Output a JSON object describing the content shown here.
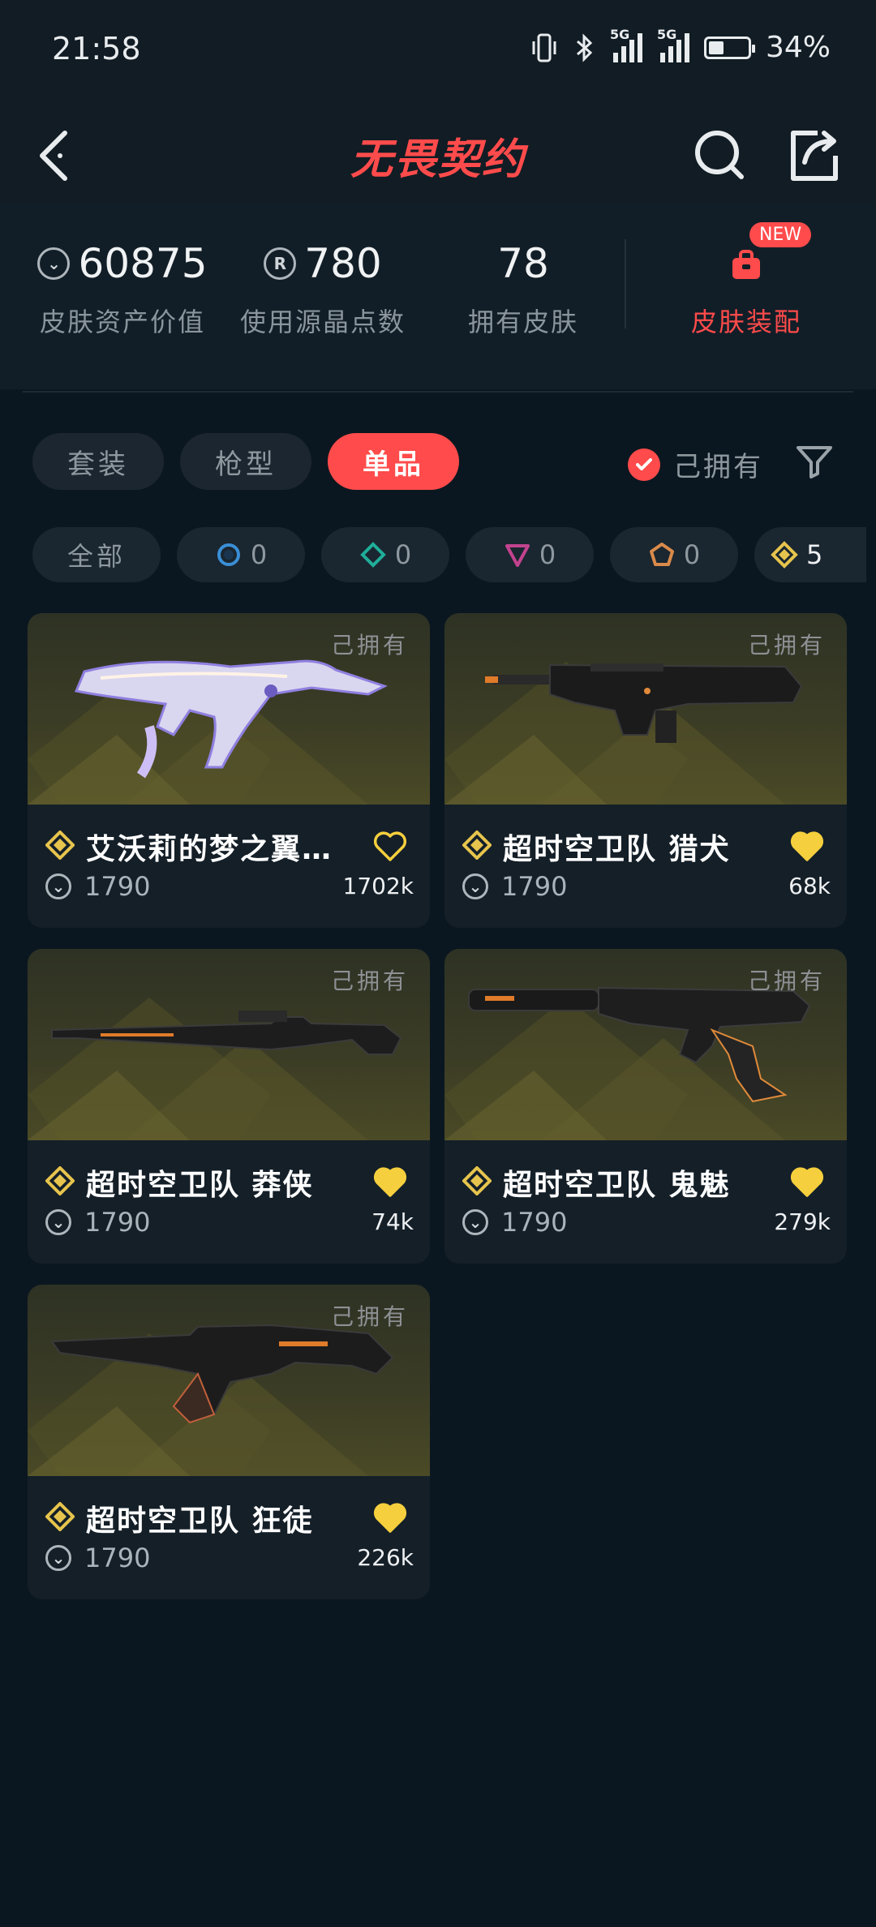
{
  "status_bar": {
    "time": "21:58",
    "network_1": "5G",
    "network_2": "5G",
    "battery": "34%"
  },
  "header": {
    "title": "无畏契约"
  },
  "stats": [
    {
      "value": "60875",
      "label": "皮肤资产价值",
      "icon": "vp-coin-icon"
    },
    {
      "value": "780",
      "label": "使用源晶点数",
      "icon": "radianite-icon"
    },
    {
      "value": "78",
      "label": "拥有皮肤"
    }
  ],
  "equip": {
    "label": "皮肤装配",
    "badge": "NEW"
  },
  "tabs": [
    "套装",
    "枪型",
    "单品"
  ],
  "active_tab": "单品",
  "owned_toggle": {
    "label": "己拥有",
    "checked": true
  },
  "rarity_chips": [
    {
      "label": "全部"
    },
    {
      "count": "0",
      "icon": "select-tier-icon",
      "color": "#3a8fd6"
    },
    {
      "count": "0",
      "icon": "deluxe-tier-icon",
      "color": "#1fae9a"
    },
    {
      "count": "0",
      "icon": "premium-tier-icon",
      "color": "#c3438f"
    },
    {
      "count": "0",
      "icon": "exclusive-tier-icon",
      "color": "#d98a4a"
    },
    {
      "count": "5",
      "icon": "ultra-tier-icon",
      "color": "#e6c44d"
    }
  ],
  "cards": [
    {
      "owned": "己拥有",
      "name": "艾沃莉的梦之翼…",
      "price": "1790",
      "likes": "1702k",
      "liked": false
    },
    {
      "owned": "己拥有",
      "name": "超时空卫队 猎犬",
      "price": "1790",
      "likes": "68k",
      "liked": true
    },
    {
      "owned": "己拥有",
      "name": "超时空卫队 莽侠",
      "price": "1790",
      "likes": "74k",
      "liked": true
    },
    {
      "owned": "己拥有",
      "name": "超时空卫队 鬼魅",
      "price": "1790",
      "likes": "279k",
      "liked": true
    },
    {
      "owned": "己拥有",
      "name": "超时空卫队 狂徒",
      "price": "1790",
      "likes": "226k",
      "liked": true
    }
  ],
  "colors": {
    "accent": "#ff4b4b",
    "background": "#0b1720",
    "card": "#141f28",
    "ultra_gold": "#e6c44d",
    "heart": "#f5cf3d"
  }
}
